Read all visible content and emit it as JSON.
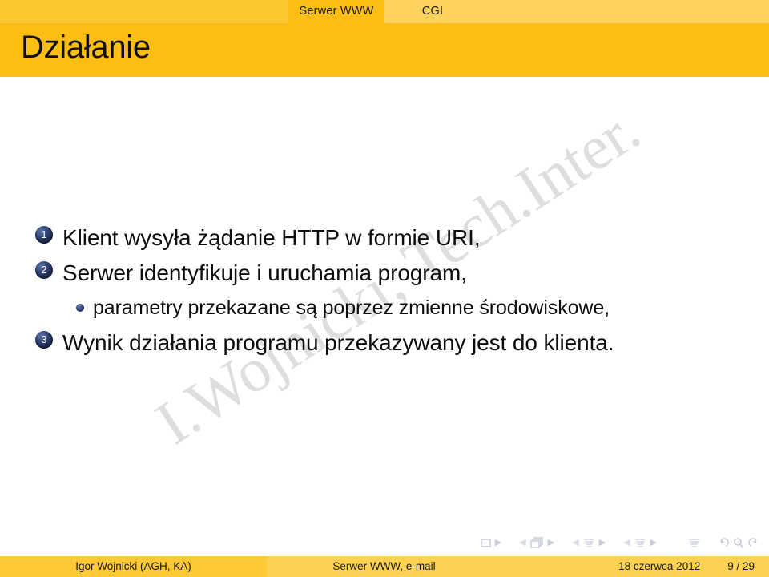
{
  "header": {
    "nav_sections": [
      {
        "label": "Serwer WWW",
        "active": true
      },
      {
        "label": "CGI",
        "active": false
      }
    ]
  },
  "title": "Działanie",
  "watermark": "I.Wojnicki, Tech.Inter.",
  "content": {
    "items": [
      {
        "number": "1",
        "text": "Klient wysyła żądanie HTTP w formie URI,"
      },
      {
        "number": "2",
        "text": "Serwer identyfikuje i uruchamia program,"
      },
      {
        "number": "3",
        "text": "Wynik działania programu przekazywany jest do klienta."
      }
    ],
    "sub_item": "parametry przekazane są poprzez zmienne środowiskowe,"
  },
  "nav_symbols": {
    "slide_icon": "slide-icon",
    "frames_icon": "frames-icon",
    "subsection_icon": "subsection-icon",
    "section_icon": "section-icon",
    "presentation_icon": "presentation-icon",
    "back_icon": "back-arrow-icon",
    "search_icon": "search-icon",
    "forward_icon": "forward-arrow-icon",
    "prev_glyph": "◀",
    "next_glyph": "▶"
  },
  "footer": {
    "author": "Igor Wojnicki  (AGH, KA)",
    "subject": "Serwer WWW, e-mail",
    "date": "18 czerwca 2012",
    "page": "9 / 29"
  },
  "colors": {
    "nav_active": "#fcbe14",
    "nav_inactive": "#fdd35e",
    "title_band": "#fcbe14",
    "footer_left": "#fdc936",
    "footer_right": "#fdd152",
    "badge": "#16213f",
    "watermark": "#dedede"
  }
}
